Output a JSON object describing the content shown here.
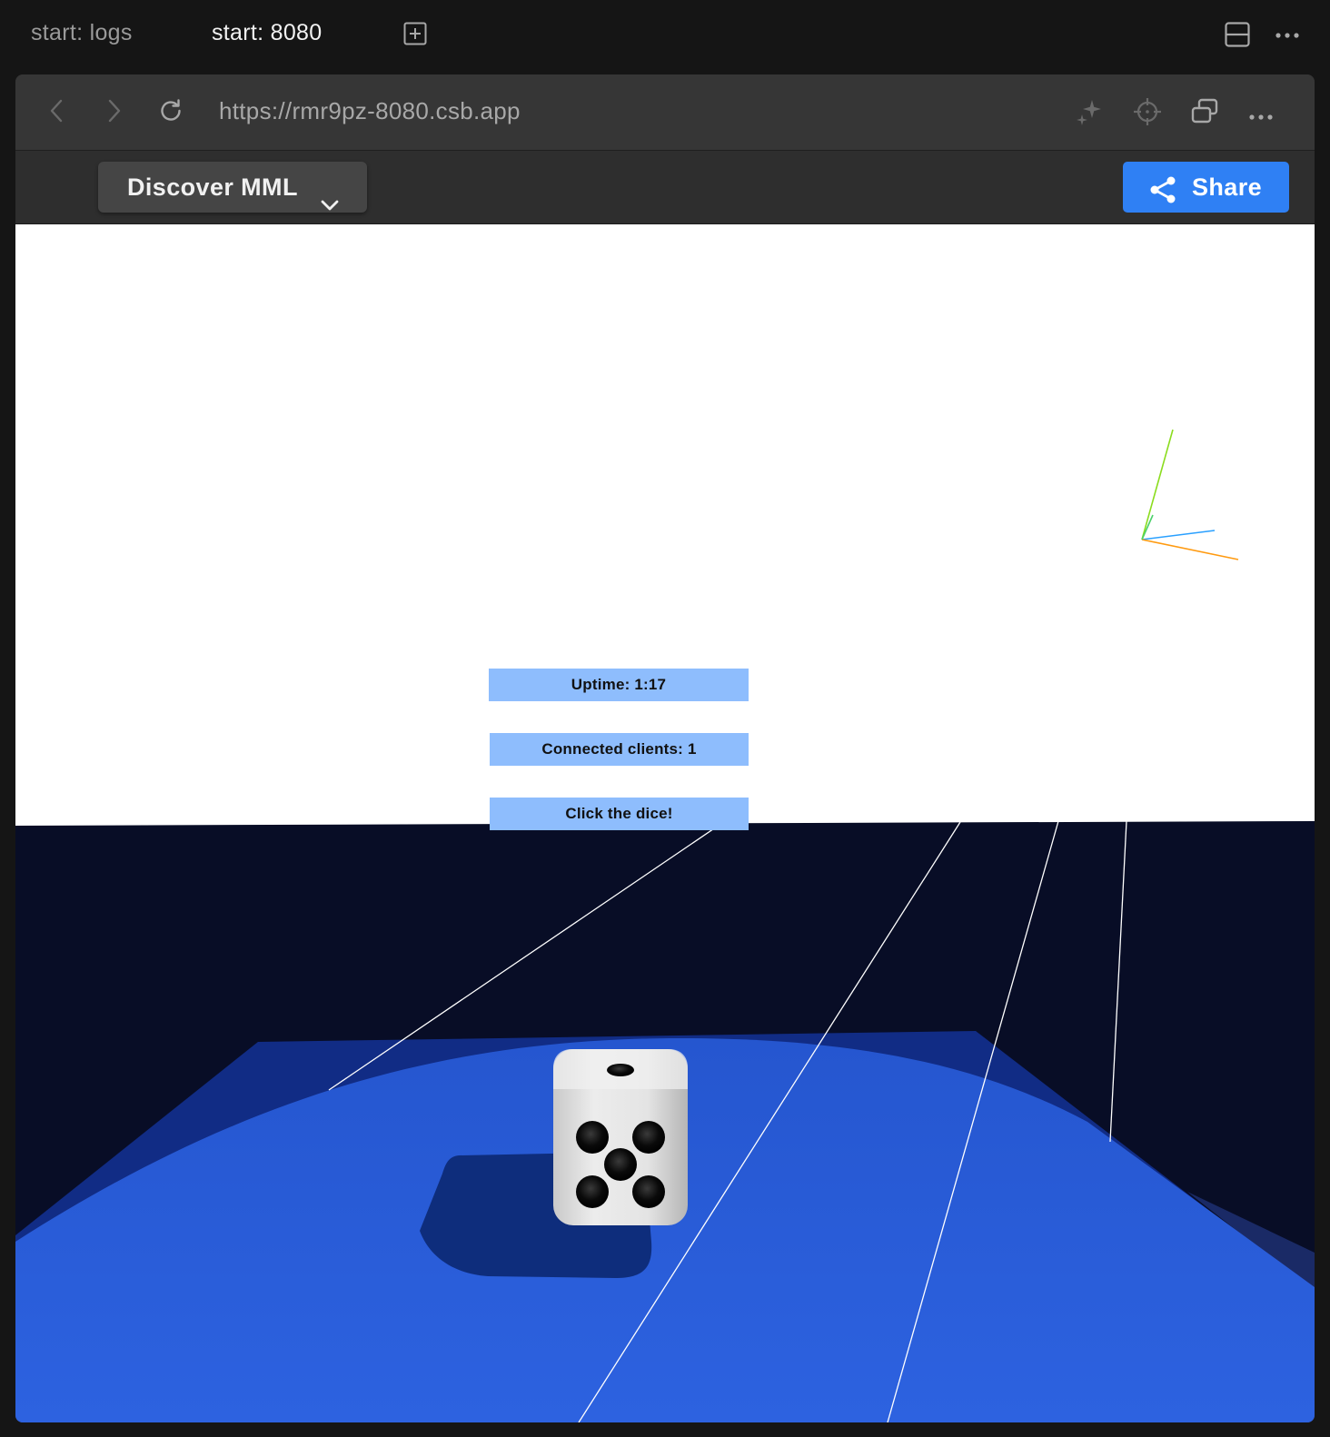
{
  "tabs": [
    {
      "label": "start: logs",
      "active": false
    },
    {
      "label": "start: 8080",
      "active": true
    }
  ],
  "tab_icons": [
    "new-tab-icon",
    "split-view-icon",
    "more-icon"
  ],
  "browser": {
    "url": "https://rmr9pz-8080.csb.app",
    "nav_icons": [
      "back-icon",
      "forward-icon",
      "reload-icon"
    ],
    "right_icons": [
      "sparkle-icon",
      "crosshair-icon",
      "open-window-icon",
      "more-icon"
    ]
  },
  "toolbar": {
    "discover_label": "Discover MML",
    "share_label": "Share",
    "share_color": "#2f80f4"
  },
  "scene": {
    "panels": {
      "uptime": "Uptime: 1:17",
      "clients": "Connected clients: 1",
      "click": "Click the dice!"
    },
    "dice_top_face": 1,
    "dice_front_face": 5,
    "colors": {
      "sky": "#ffffff",
      "ground": "#080d26",
      "floor": "#2c5fd9",
      "panel": "#8ebdfd"
    }
  }
}
